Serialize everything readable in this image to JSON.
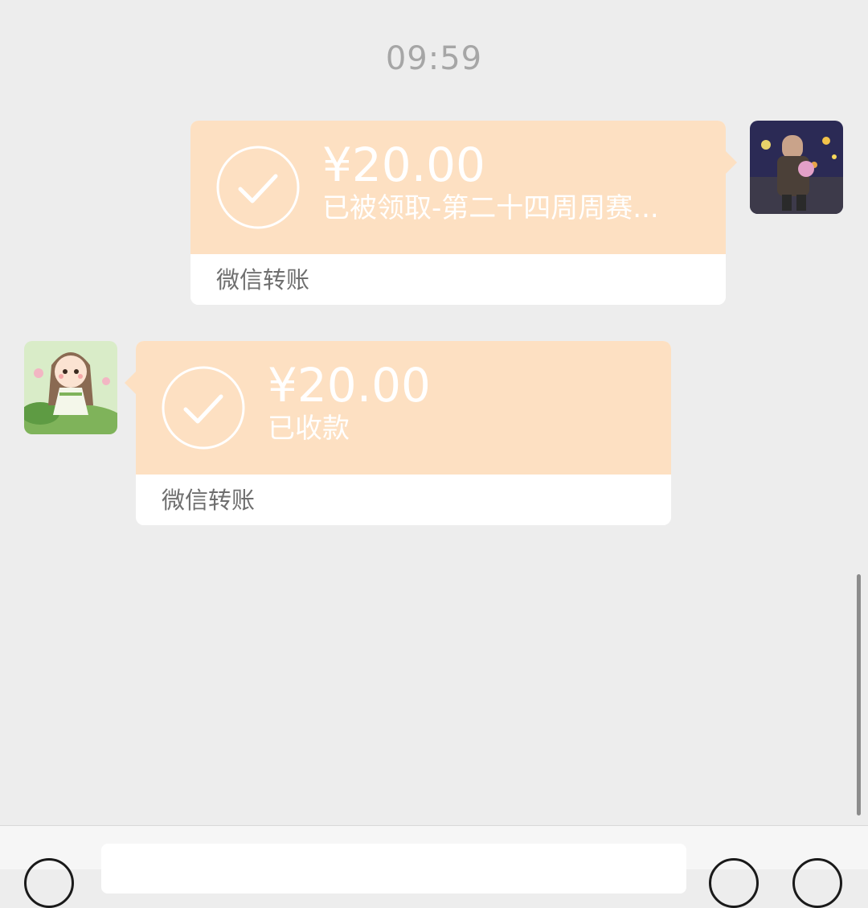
{
  "chat": {
    "timestamp": "09:59",
    "messages": [
      {
        "sender": "self",
        "avatar_icon": "avatar-night-street-photo",
        "amount": "¥20.00",
        "status": "已被领取-第二十四周周赛...",
        "label": "微信转账",
        "check_icon": "checkmark-circle-icon"
      },
      {
        "sender": "other",
        "avatar_icon": "avatar-cartoon-girl",
        "amount": "¥20.00",
        "status": "已收款",
        "label": "微信转账",
        "check_icon": "checkmark-circle-icon"
      }
    ]
  },
  "input_bar": {
    "voice_icon": "voice-icon",
    "emoji_icon": "emoji-icon",
    "plus_icon": "plus-icon",
    "text_value": ""
  },
  "colors": {
    "background": "#ededed",
    "card_accent": "#fde0c2",
    "card_text": "#ffffff",
    "label_text": "#6f6f6f",
    "timestamp_text": "#a6a6a6"
  }
}
